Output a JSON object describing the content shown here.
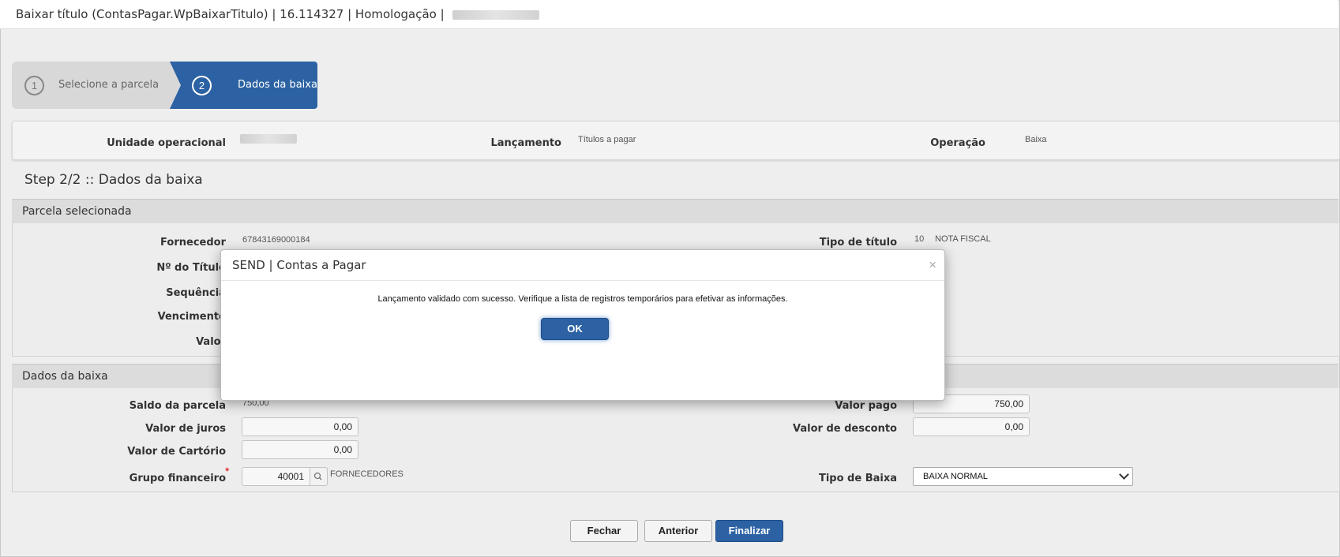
{
  "titlebar": {
    "title": "Baixar título (ContasPagar.WpBaixarTitulo) | 16.114327 | Homologação |"
  },
  "wizard": {
    "steps": [
      {
        "number": "1",
        "label": "Selecione a parcela"
      },
      {
        "number": "2",
        "label": "Dados da baixa"
      }
    ]
  },
  "info": {
    "unidade_label": "Unidade operacional",
    "lancamento_label": "Lançamento",
    "lancamento_value": "Títulos a pagar",
    "operacao_label": "Operação",
    "operacao_value": "Baixa"
  },
  "step_title": "Step 2/2 :: Dados da baixa",
  "parcela": {
    "header": "Parcela selecionada",
    "fornecedor_label": "Fornecedor",
    "fornecedor_value": "67843169000184",
    "titulo_label": "Nº do Título",
    "sequencia_label": "Sequência",
    "vencimento_label": "Vencimento",
    "valor_label": "Valor",
    "tipo_titulo_label": "Tipo de título",
    "tipo_titulo_code": "10",
    "tipo_titulo_value": "NOTA FISCAL"
  },
  "baixa": {
    "header": "Dados da baixa",
    "saldo_label": "Saldo da parcela",
    "saldo_value": "750,00",
    "juros_label": "Valor de juros",
    "juros_value": "0,00",
    "cartorio_label": "Valor de Cartório",
    "cartorio_value": "0,00",
    "grupo_label": "Grupo financeiro",
    "grupo_required": "*",
    "grupo_code": "40001",
    "grupo_value": "FORNECEDORES",
    "valor_pago_label": "Valor pago",
    "valor_pago_value": "750,00",
    "desconto_label": "Valor de desconto",
    "desconto_value": "0,00",
    "tipo_baixa_label": "Tipo de Baixa",
    "tipo_baixa_value": "BAIXA NORMAL"
  },
  "actions": {
    "fechar": "Fechar",
    "anterior": "Anterior",
    "finalizar": "Finalizar"
  },
  "modal": {
    "title": "SEND | Contas a Pagar",
    "close": "×",
    "message": "Lançamento validado com sucesso. Verifique a lista de registros temporários para efetivar as informações.",
    "ok": "OK"
  },
  "colors": {
    "primary": "#2c62a3",
    "required": "#dd0000"
  },
  "icons": {
    "lookup": "search-icon",
    "select": "chevron-down-icon"
  }
}
